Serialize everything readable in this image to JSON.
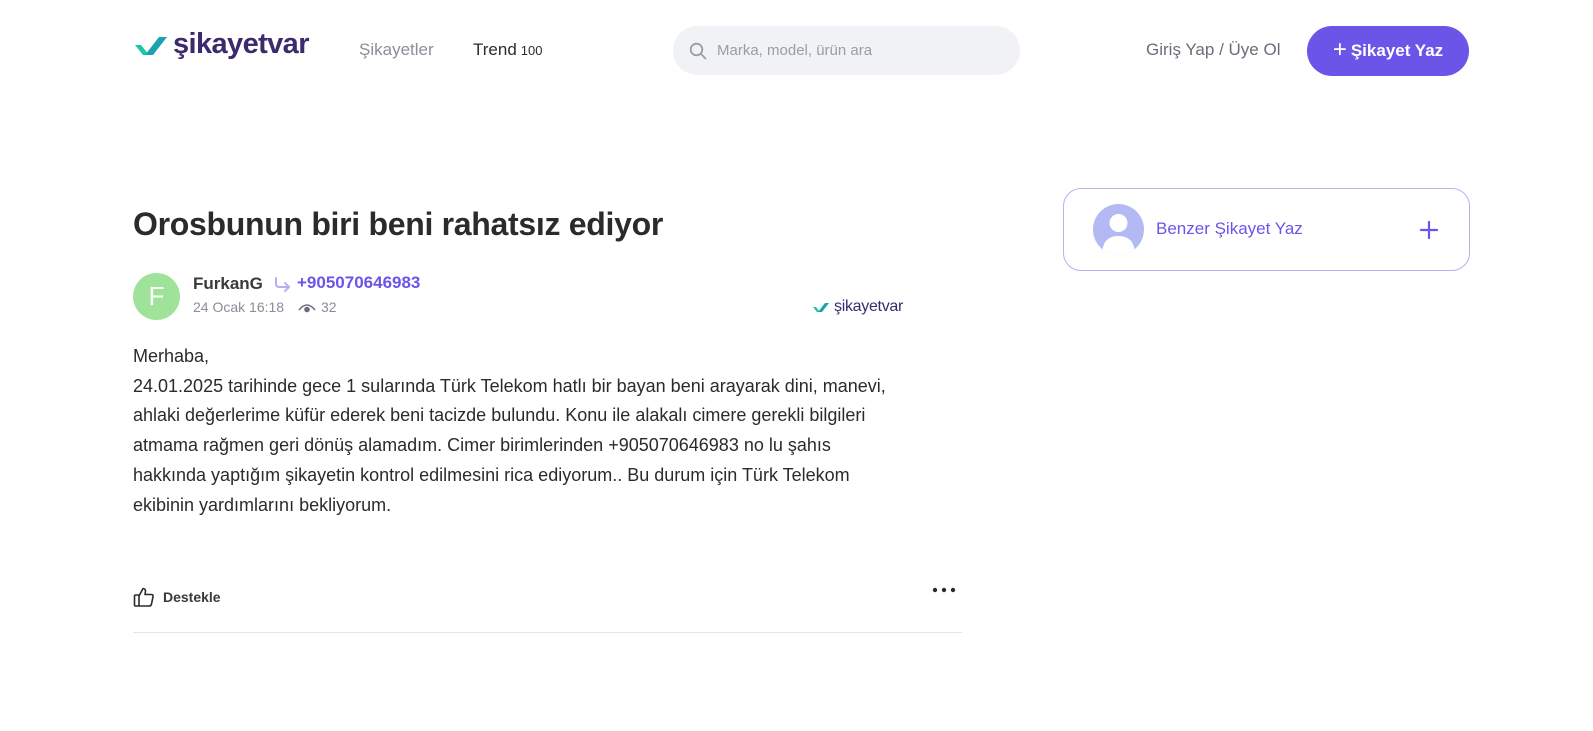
{
  "header": {
    "logo_text": "şikayetvar",
    "nav": {
      "complaints": "Şikayetler",
      "trend": "Trend",
      "trend_count": "100"
    },
    "search_placeholder": "Marka, model, ürün ara",
    "login": "Giriş Yap / Üye Ol",
    "write_button": "Şikayet Yaz"
  },
  "complaint": {
    "title": "Orosbunun biri beni rahatsız ediyor",
    "author_initial": "F",
    "author": "FurkanG",
    "target": "+905070646983",
    "date": "24 Ocak 16:18",
    "views": "32",
    "watermark": "şikayetvar",
    "body_lines": [
      "Merhaba,",
      "24.01.2025 tarihinde gece 1 sularında Türk Telekom hatlı bir bayan beni arayarak dini, manevi,",
      "ahlaki değerlerime küfür ederek beni tacizde bulundu. Konu ile alakalı cimere gerekli bilgileri",
      "atmama rağmen geri dönüş alamadım. Cimer birimlerinden +905070646983 no lu şahıs",
      "hakkında yaptığım şikayetin kontrol edilmesini rica ediyorum.. Bu durum için Türk Telekom",
      "ekibinin yardımlarını bekliyorum."
    ],
    "support_label": "Destekle"
  },
  "sidebar": {
    "similar_label": "Benzer Şikayet Yaz"
  },
  "colors": {
    "accent": "#6b55e8",
    "logo_green": "#19c6a7",
    "avatar_green": "#9fe39a",
    "card_border": "#b9b0f2"
  },
  "icons": [
    "logo-check-icon",
    "search-icon",
    "plus-icon",
    "reply-arrow-icon",
    "eye-icon",
    "thumbs-up-icon",
    "more-dots-icon",
    "user-silhouette-icon"
  ]
}
